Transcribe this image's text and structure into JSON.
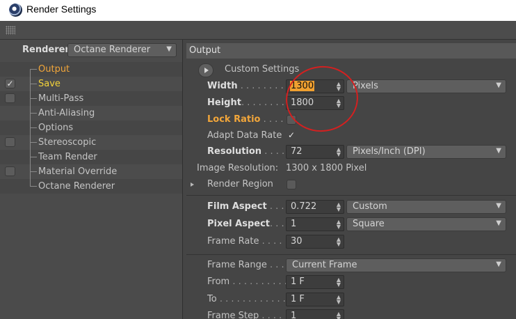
{
  "window": {
    "title": "Render Settings"
  },
  "left_panel": {
    "renderer_label": "Renderer",
    "renderer_value": "Octane Renderer",
    "items": [
      {
        "label": "Output",
        "checkbox": false,
        "checked": false,
        "color": "orange"
      },
      {
        "label": "Save",
        "checkbox": true,
        "checked": true,
        "color": "yellow"
      },
      {
        "label": "Multi-Pass",
        "checkbox": true,
        "checked": false,
        "color": "normal"
      },
      {
        "label": "Anti-Aliasing",
        "checkbox": false,
        "checked": false,
        "color": "normal"
      },
      {
        "label": "Options",
        "checkbox": false,
        "checked": false,
        "color": "normal"
      },
      {
        "label": "Stereoscopic",
        "checkbox": true,
        "checked": false,
        "color": "normal"
      },
      {
        "label": "Team Render",
        "checkbox": false,
        "checked": false,
        "color": "normal"
      },
      {
        "label": "Material Override",
        "checkbox": true,
        "checked": false,
        "color": "normal"
      },
      {
        "label": "Octane Renderer",
        "checkbox": false,
        "checked": false,
        "color": "normal"
      }
    ]
  },
  "output": {
    "header": "Output",
    "custom_settings": "Custom Settings",
    "width": {
      "label": "Width",
      "dots": " . . . . . . . . .",
      "value": "1300",
      "unit": "Pixels"
    },
    "height": {
      "label": "Height",
      "dots": ". . . . . . . . .",
      "value": "1800"
    },
    "lock_ratio": {
      "label": "Lock Ratio",
      "dots": " . . . . .",
      "checked": false
    },
    "adapt_data_rate": {
      "label": "Adapt Data Rate",
      "checked": true,
      "check_glyph": "✓"
    },
    "resolution": {
      "label": "Resolution",
      "dots": " . . . . .",
      "value": "72",
      "unit": "Pixels/Inch (DPI)"
    },
    "image_resolution": {
      "label": "Image Resolution:",
      "value": "1300 x 1800 Pixel"
    },
    "render_region": {
      "label": "Render Region",
      "checked": false
    },
    "film_aspect": {
      "label": "Film Aspect",
      "dots": " . . . .",
      "value": "0.722",
      "preset": "Custom"
    },
    "pixel_aspect": {
      "label": "Pixel Aspect",
      "dots": ". . . .",
      "value": "1",
      "preset": "Square"
    },
    "frame_rate": {
      "label": "Frame Rate",
      "dots": " . . . . .",
      "value": "30"
    },
    "frame_range": {
      "label": "Frame Range",
      "dots": " . . .",
      "value": "Current Frame"
    },
    "from": {
      "label": "From",
      "dots": " . . . . . . . . . .",
      "value": "1 F"
    },
    "to": {
      "label": "To",
      "dots": " . . . . . . . . . . . . .",
      "value": "1 F"
    },
    "frame_step": {
      "label": "Frame Step",
      "dots": " . . . .",
      "value": "1"
    }
  },
  "colors": {
    "accent_orange": "#f2a63a",
    "save_yellow": "#f5d43a",
    "annotation_red": "#d42020"
  }
}
